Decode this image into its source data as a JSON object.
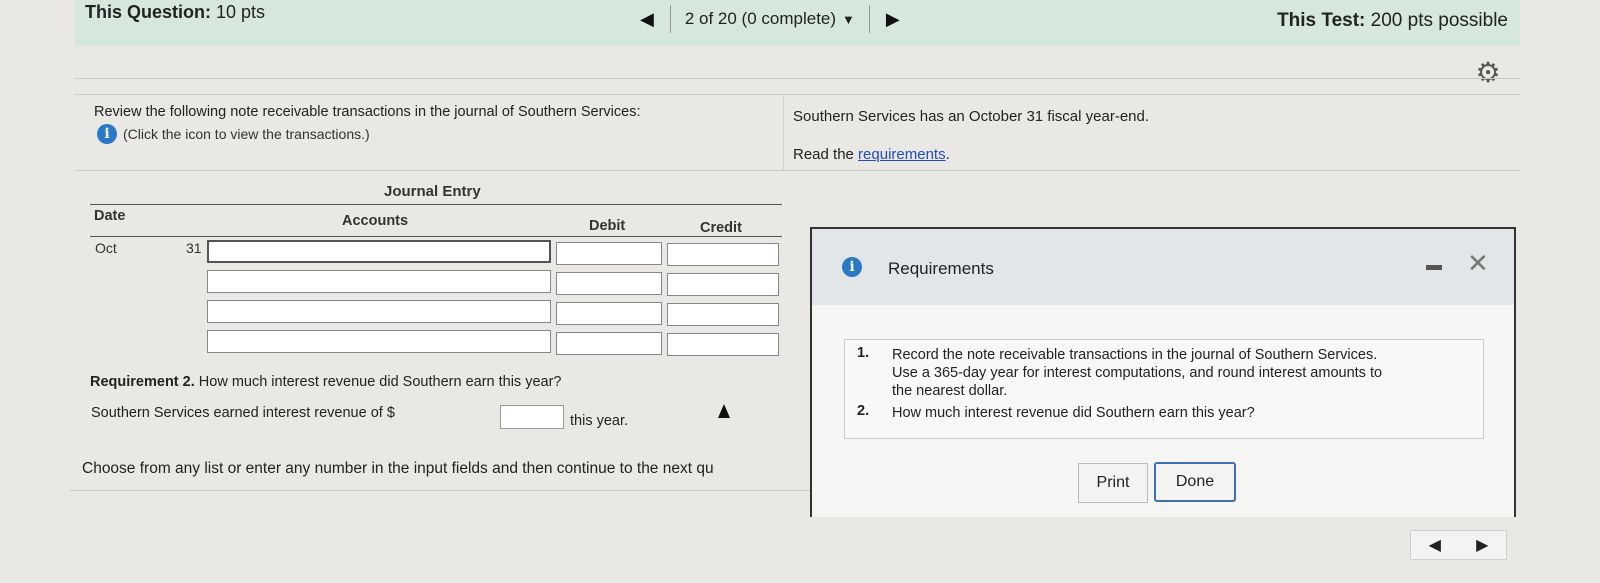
{
  "header": {
    "question_label": "This Question:",
    "question_points": "10 pts",
    "position": "2 of 20 (0 complete)",
    "test_label": "This Test:",
    "test_points": "200 pts possible",
    "prev_icon": "triangle-left-icon",
    "next_icon": "triangle-right-icon",
    "settings_icon": "gear-icon"
  },
  "problem": {
    "prompt": "Review the following note receivable transactions in the journal of Southern Services:",
    "hint": "(Click the icon to view the transactions.)",
    "fiscal_year": "Southern Services has an October 31 fiscal year-end.",
    "read_prefix": "Read the ",
    "read_link": "requirements",
    "read_suffix": "."
  },
  "journal": {
    "title": "Journal Entry",
    "headers": {
      "date": "Date",
      "accounts": "Accounts",
      "debit": "Debit",
      "credit": "Credit"
    },
    "month": "Oct",
    "day": "31",
    "rows": 4
  },
  "requirement2": {
    "label": "Requirement 2.",
    "question": " How much interest revenue did Southern earn this year?",
    "answer_prefix": "Southern Services earned interest revenue of $",
    "answer_value": "",
    "answer_suffix": "this year."
  },
  "footer": {
    "instruction": "Choose from any list or enter any number in the input fields and then continue to the next qu"
  },
  "modal": {
    "title": "Requirements",
    "items": [
      {
        "num": "1.",
        "lines": [
          "Record the note receivable transactions in the journal of Southern Services.",
          "Use a 365-day year for interest computations, and round interest amounts to",
          "the nearest dollar."
        ]
      },
      {
        "num": "2.",
        "lines": [
          "How much interest revenue did Southern earn this year?"
        ]
      }
    ],
    "print_label": "Print",
    "done_label": "Done"
  },
  "colors": {
    "header_bg": "#d6e8dd",
    "link": "#1f4fc4",
    "info_icon": "#2a79c6",
    "done_border": "#3c6fb8"
  }
}
